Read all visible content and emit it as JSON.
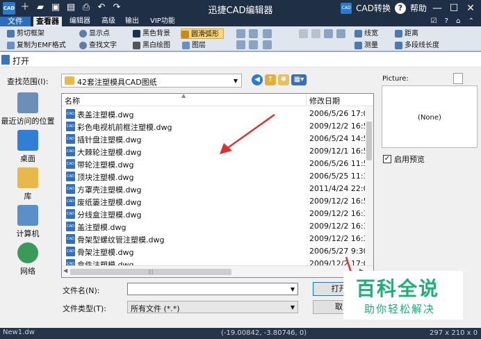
{
  "app": {
    "logo_text": "CAD",
    "title": "迅捷CAD编辑器",
    "cad_convert": "CAD转换",
    "help": "帮助",
    "win_min": "—",
    "win_max": "☐",
    "win_close": "✕"
  },
  "ribbon_tabs": {
    "file": "文件",
    "items": [
      "查看器",
      "编辑器",
      "高级",
      "输出",
      "VIP功能"
    ]
  },
  "ribbon": {
    "crop_frame": "剪切框架",
    "copy_emf": "复制为EMF格式",
    "show_points": "显示点",
    "find_text": "查找文字",
    "black_bg": "黑色背景",
    "bw_drawing": "黑白绘图",
    "smooth_arc": "圆滑弧形",
    "layers": "图层",
    "line_width": "线宽",
    "measure": "测量",
    "distance": "距离",
    "polyline_length": "多段线长度"
  },
  "dialog": {
    "title": "打开",
    "look_in_label": "查找范围(I):",
    "look_in_value": "42套注塑模具CAD图纸",
    "places": [
      {
        "label": "最近访问的位置",
        "icon": "recent-places-icon",
        "color": "#6b8fb8"
      },
      {
        "label": "桌面",
        "icon": "desktop-icon",
        "color": "#2f7fd6"
      },
      {
        "label": "库",
        "icon": "library-icon",
        "color": "#e8b84a"
      },
      {
        "label": "计算机",
        "icon": "computer-icon",
        "color": "#5b8fc9"
      },
      {
        "label": "网络",
        "icon": "network-icon",
        "color": "#3a9a5a"
      }
    ],
    "columns": {
      "name": "名称",
      "date": "修改日期"
    },
    "files": [
      {
        "name": "表盖注塑模.dwg",
        "date": "2006/5/26 17:0"
      },
      {
        "name": "彩色电视机前框注塑模.dwg",
        "date": "2009/12/2 16:5"
      },
      {
        "name": "插针盘注塑模.dwg",
        "date": "2006/5/24 14:5"
      },
      {
        "name": "大棘轮注塑模.dwg",
        "date": "2009/12/1 16:5"
      },
      {
        "name": "带轮注塑模.dwg",
        "date": "2006/5/26 11:5"
      },
      {
        "name": "顶块注塑模.dwg",
        "date": "2006/5/25 11:3"
      },
      {
        "name": "方罩壳注塑模.dwg",
        "date": "2011/4/24 22:0"
      },
      {
        "name": "废纸篓注塑模.dwg",
        "date": "2009/12/2 16:5"
      },
      {
        "name": "分线盒注塑模.dwg",
        "date": "2009/12/2 16:3"
      },
      {
        "name": "盖注塑模.dwg",
        "date": "2009/12/2 16:3"
      },
      {
        "name": "骨架型螺纹管注塑模.dwg",
        "date": "2009/12/2 16:3"
      },
      {
        "name": "骨架注塑模.dwg",
        "date": "2006/5/27 9:30"
      },
      {
        "name": "盒件注塑模.dwg",
        "date": "2009/12/2 17:0"
      }
    ],
    "file_icon_text": "CAD",
    "scroll_grip": "|||",
    "preview_label": "Picture:",
    "preview_none": "(None)",
    "enable_preview": "启用预览",
    "filename_label": "文件名(N):",
    "filename_value": "",
    "filetype_label": "文件类型(T):",
    "filetype_value": "所有文件 (*.*)",
    "open_button": "打开",
    "cancel_button": "取"
  },
  "watermark": {
    "big": "百科全说",
    "small": "助你轻松解决"
  },
  "status": {
    "tab": "New1.dw",
    "coords": "(-19.00842, -3.80746, 0)",
    "size": "297 x 210 x 0"
  },
  "colors": {
    "accent": "#2a6fbf",
    "arrow": "#e0302c",
    "watermark": "#1bb074"
  }
}
